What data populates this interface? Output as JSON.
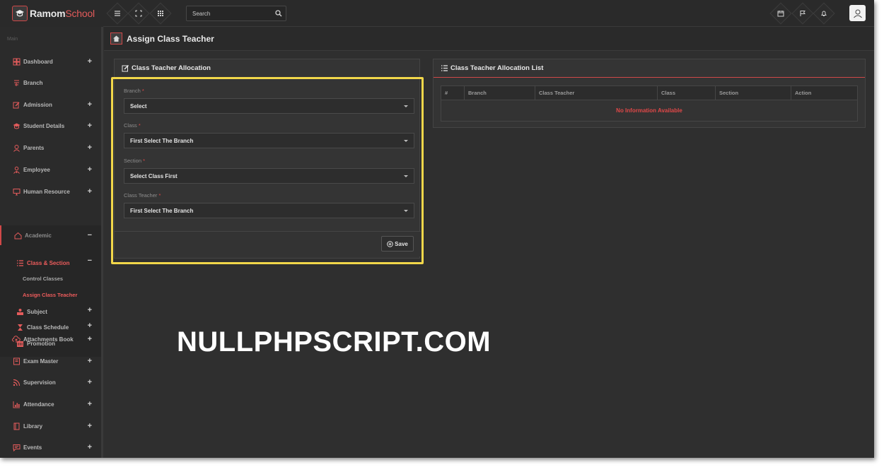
{
  "app": {
    "logo_main": "Ramom",
    "logo_sub": "School"
  },
  "topbar": {
    "search_placeholder": "Search"
  },
  "sidebar": {
    "section_label": "Main",
    "items": [
      {
        "label": "Dashboard",
        "icon": "dashboard-icon",
        "expand": "+"
      },
      {
        "label": "Branch",
        "icon": "branch-icon",
        "expand": ""
      },
      {
        "label": "Admission",
        "icon": "edit-icon",
        "expand": "+"
      },
      {
        "label": "Student Details",
        "icon": "graduation-cap-icon",
        "expand": "+"
      },
      {
        "label": "Parents",
        "icon": "user-icon",
        "expand": "+"
      },
      {
        "label": "Employee",
        "icon": "employee-icon",
        "expand": "+"
      },
      {
        "label": "Human Resource",
        "icon": "monitor-icon",
        "expand": "+"
      },
      {
        "label": "Academic",
        "icon": "home-icon",
        "expand": "−"
      },
      {
        "label": "Attachments Book",
        "icon": "cloud-upload-icon",
        "expand": "+"
      },
      {
        "label": "Exam Master",
        "icon": "book-icon",
        "expand": "+"
      },
      {
        "label": "Supervision",
        "icon": "rss-icon",
        "expand": "+"
      },
      {
        "label": "Attendance",
        "icon": "bar-chart-icon",
        "expand": "+"
      },
      {
        "label": "Library",
        "icon": "library-icon",
        "expand": "+"
      },
      {
        "label": "Events",
        "icon": "message-icon",
        "expand": "+"
      }
    ],
    "academic_sub": {
      "class_section": "Class & Section",
      "class_section_expand": "−",
      "control_classes": "Control Classes",
      "assign_class_teacher": "Assign Class Teacher",
      "subject": "Subject",
      "subject_expand": "+",
      "class_schedule": "Class Schedule",
      "class_schedule_expand": "+",
      "promotion": "Promotion"
    }
  },
  "page": {
    "title": "Assign Class Teacher"
  },
  "form": {
    "title": "Class Teacher Allocation",
    "required_mark": "*",
    "fields": [
      {
        "label": "Branch",
        "value": "Select"
      },
      {
        "label": "Class",
        "value": "First Select The Branch"
      },
      {
        "label": "Section",
        "value": "Select Class First"
      },
      {
        "label": "Class Teacher",
        "value": "First Select The Branch"
      }
    ],
    "save_label": "Save"
  },
  "list": {
    "title": "Class Teacher Allocation List",
    "columns": [
      "#",
      "Branch",
      "Class Teacher",
      "Class",
      "Section",
      "Action"
    ],
    "empty_message": "No Information Available"
  },
  "watermark": "NULLPHPSCRIPT.COM",
  "colors": {
    "accent": "#e04848",
    "highlight": "#f2d74a",
    "background": "#2f2f2f"
  }
}
